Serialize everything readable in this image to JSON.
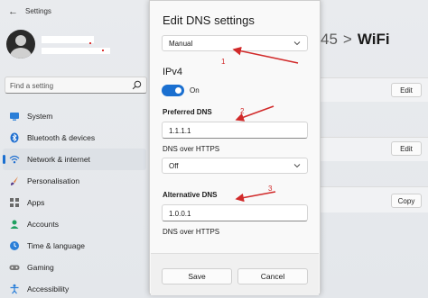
{
  "settings": {
    "window_title": "Settings",
    "search_placeholder": "Find a setting",
    "nav_items": [
      {
        "label": "System",
        "icon": "monitor-icon"
      },
      {
        "label": "Bluetooth & devices",
        "icon": "bluetooth-icon"
      },
      {
        "label": "Network & internet",
        "icon": "wifi-icon"
      },
      {
        "label": "Personalisation",
        "icon": "brush-icon"
      },
      {
        "label": "Apps",
        "icon": "apps-icon"
      },
      {
        "label": "Accounts",
        "icon": "person-icon"
      },
      {
        "label": "Time & language",
        "icon": "globe-clock-icon"
      },
      {
        "label": "Gaming",
        "icon": "gamepad-icon"
      },
      {
        "label": "Accessibility",
        "icon": "accessibility-icon"
      }
    ],
    "active_nav": "Network & internet",
    "breadcrumb_prev": "45",
    "breadcrumb_sep": ">",
    "breadcrumb_current": "WiFi",
    "right_buttons": [
      "Edit",
      "Edit",
      "Copy"
    ]
  },
  "dialog": {
    "title": "Edit DNS settings",
    "mode_value": "Manual",
    "ipv4_heading": "IPv4",
    "ipv4_toggle_label": "On",
    "preferred_label": "Preferred DNS",
    "preferred_value": "1.1.1.1",
    "preferred_https_label": "DNS over HTTPS",
    "preferred_https_value": "Off",
    "alternative_label": "Alternative DNS",
    "alternative_value": "1.0.0.1",
    "alternative_https_label": "DNS over HTTPS",
    "save_label": "Save",
    "cancel_label": "Cancel"
  },
  "annotations": {
    "n1": "1",
    "n2": "2",
    "n3": "3"
  },
  "colors": {
    "accent": "#1a6fd0",
    "annotation": "#d12a2a"
  }
}
